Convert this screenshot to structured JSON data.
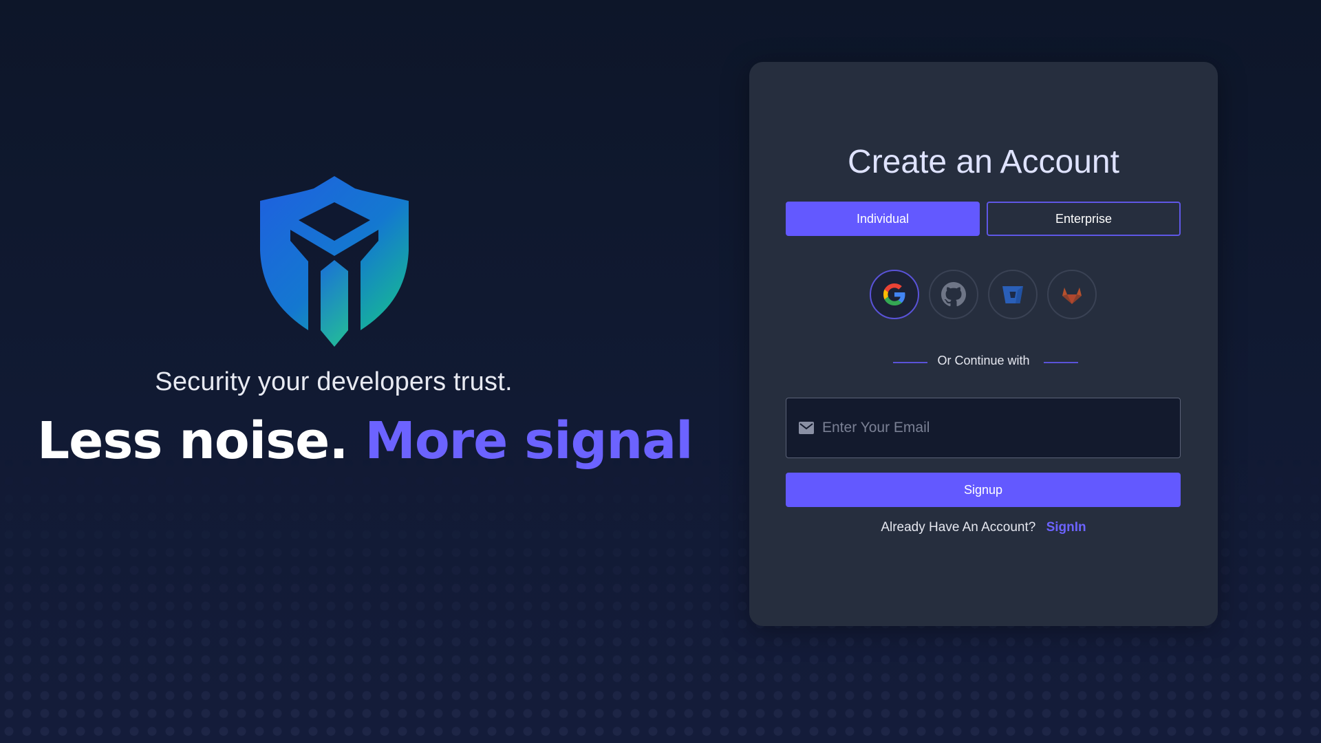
{
  "brand": {
    "logo_icon": "shield-m-logo-icon",
    "tagline": "Security your developers trust.",
    "headline_part1": "Less noise.",
    "headline_part2": "More signal",
    "accent_color": "#6c63ff"
  },
  "signup_card": {
    "title": "Create an Account",
    "tabs": [
      {
        "label": "Individual",
        "active": true
      },
      {
        "label": "Enterprise",
        "active": false
      }
    ],
    "social_providers": [
      {
        "name": "google",
        "icon": "google-icon",
        "selected": true
      },
      {
        "name": "github",
        "icon": "github-icon",
        "selected": false
      },
      {
        "name": "bitbucket",
        "icon": "bitbucket-icon",
        "selected": false
      },
      {
        "name": "gitlab",
        "icon": "gitlab-icon",
        "selected": false
      }
    ],
    "divider_text": "Or Continue with",
    "email": {
      "icon": "mail-icon",
      "placeholder": "Enter Your Email",
      "value": ""
    },
    "signup_label": "Signup",
    "signin_prompt": "Already Have An Account?",
    "signin_link": "SignIn",
    "button_color": "#6359ff"
  }
}
